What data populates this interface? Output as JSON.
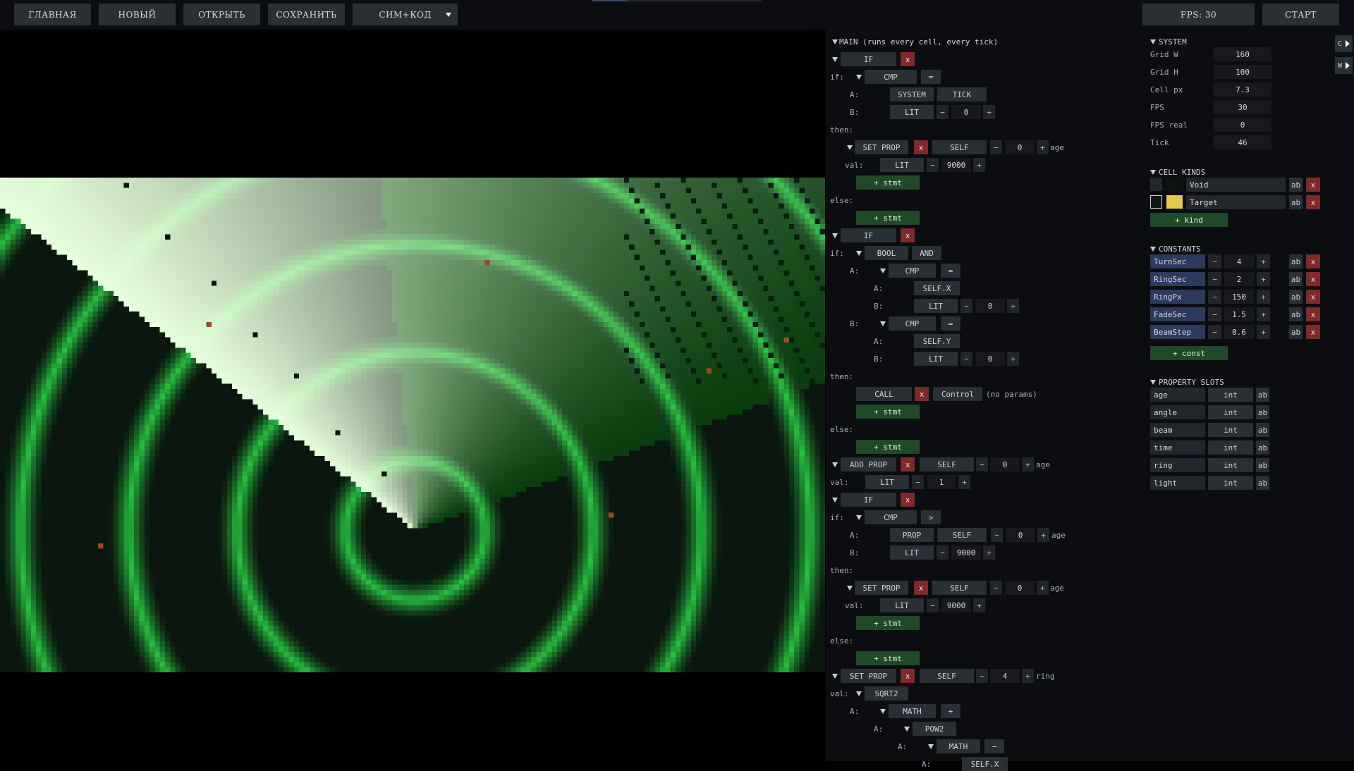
{
  "toolbar": {
    "buttons": [
      "ГЛАВНАЯ",
      "НОВЫЙ",
      "ОТКРЫТЬ",
      "СОХРАНИТЬ"
    ],
    "mode_select": "СИМ+КОД",
    "fps_label": "FPS: 30",
    "start_label": "СТАРТ"
  },
  "side_strip": {
    "c_label": "C",
    "w_label": "W"
  },
  "code": {
    "main_header": "MAIN (runs every cell, every tick)",
    "words": {
      "if": "IF",
      "if_label": "if:",
      "then_label": "then:",
      "else_label": "else:",
      "a": "A:",
      "b": "B:",
      "val": "val:",
      "cmp": "CMP",
      "eq": "=",
      "gt": ">",
      "system": "SYSTEM",
      "tick": "TICK",
      "lit": "LIT",
      "self": "SELF",
      "set_prop": "SET PROP",
      "add_prop": "ADD PROP",
      "stmt": "+ stmt",
      "bool": "BOOL",
      "and": "AND",
      "self_x": "SELF.X",
      "self_y": "SELF.Y",
      "call": "CALL",
      "control": "Control",
      "no_params": "(no params)",
      "prop": "PROP",
      "sqrt2": "SQRT2",
      "math": "MATH",
      "plus": "+",
      "minus": "−",
      "pow2": "POW2",
      "x": "x"
    },
    "nums": {
      "zero": "0",
      "n9000": "9000",
      "one": "1",
      "four": "4"
    },
    "props": {
      "age": "age",
      "ring": "ring"
    }
  },
  "system": {
    "title": "SYSTEM",
    "fields": [
      {
        "label": "Grid W",
        "value": "160"
      },
      {
        "label": "Grid H",
        "value": "100"
      },
      {
        "label": "Cell px",
        "value": "7.3"
      },
      {
        "label": "FPS",
        "value": "30"
      },
      {
        "label": "FPS real",
        "value": "0"
      },
      {
        "label": "Tick",
        "value": "46"
      }
    ]
  },
  "cell_kinds": {
    "title": "CELL KINDS",
    "items": [
      {
        "name": "Void",
        "color": "#0b1410"
      },
      {
        "name": "Target",
        "color": "#e8c84a"
      }
    ],
    "add_label": "+ kind"
  },
  "constants": {
    "title": "CONSTANTS",
    "items": [
      {
        "name": "TurnSec",
        "value": "4"
      },
      {
        "name": "RingSec",
        "value": "2"
      },
      {
        "name": "RingPx",
        "value": "150"
      },
      {
        "name": "FadeSec",
        "value": "1.5"
      },
      {
        "name": "BeamStep",
        "value": "0.6"
      }
    ],
    "add_label": "+ const"
  },
  "property_slots": {
    "title": "PROPERTY SLOTS",
    "items": [
      {
        "name": "age",
        "type": "int"
      },
      {
        "name": "angle",
        "type": "int"
      },
      {
        "name": "beam",
        "type": "int"
      },
      {
        "name": "time",
        "type": "int"
      },
      {
        "name": "ring",
        "type": "int"
      },
      {
        "name": "light",
        "type": "int"
      }
    ]
  },
  "common": {
    "ab": "ab",
    "x": "x",
    "minus": "−",
    "plus": "+"
  },
  "colors": {
    "accent_green": "#1f4a28",
    "delete_red": "#7c2a2a",
    "radar_green": "#22c03c",
    "beam_light": "#e6ffe0"
  }
}
